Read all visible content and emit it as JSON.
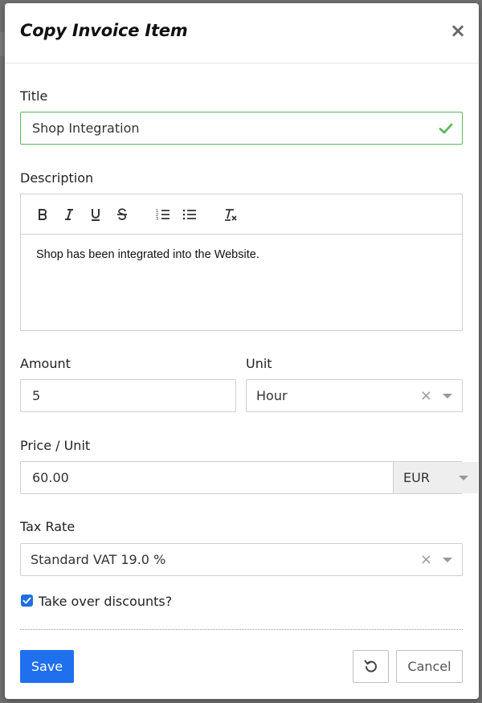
{
  "modal": {
    "title": "Copy Invoice Item",
    "close_symbol": "×"
  },
  "form": {
    "title_label": "Title",
    "title_value": "Shop Integration",
    "description_label": "Description",
    "description_text": "Shop has been integrated into the Website.",
    "toolbar": [
      "bold-icon",
      "italic-icon",
      "underline-icon",
      "strikethrough-icon",
      "ordered-list-icon",
      "bullet-list-icon",
      "clear-format-icon"
    ],
    "amount_label": "Amount",
    "amount_value": "5",
    "unit_label": "Unit",
    "unit_value": "Hour",
    "price_label": "Price / Unit",
    "price_value": "60.00",
    "currency_value": "EUR",
    "tax_label": "Tax Rate",
    "tax_value": "Standard VAT 19.0 %",
    "discount_label": "Take over discounts?",
    "discount_checked": true
  },
  "actions": {
    "save_label": "Save",
    "reset_icon": "undo-icon",
    "cancel_label": "Cancel"
  },
  "colors": {
    "primary": "#1f6fef",
    "valid": "#5cb85c"
  }
}
